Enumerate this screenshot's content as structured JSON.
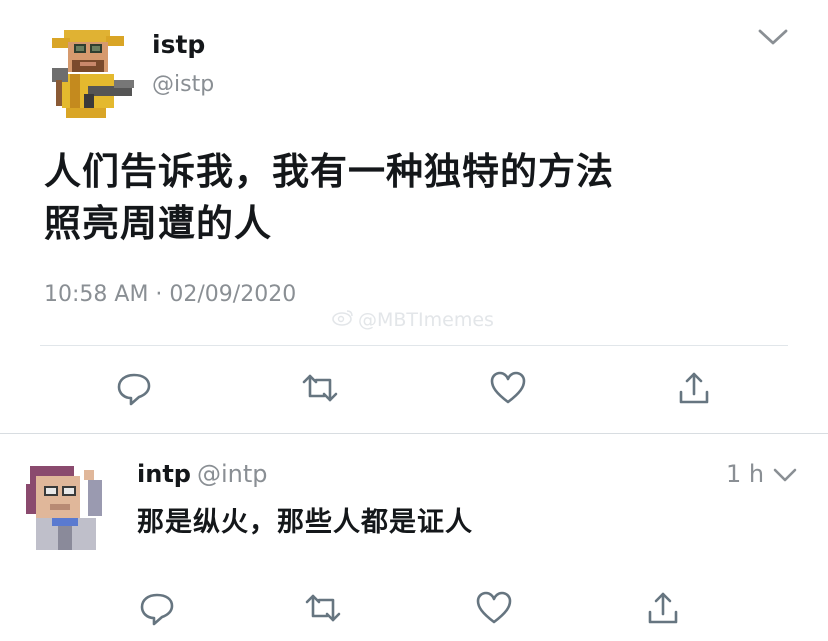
{
  "tweet": {
    "author_name": "istp",
    "author_handle": "@istp",
    "text_line1": "人们告诉我，我有一种独特的方法",
    "text_line2": "照亮周遭的人",
    "timestamp": "10:58 AM · 02/09/2020",
    "watermark": "@MBTImemes",
    "actions": [
      "reply-icon",
      "retweet-icon",
      "like-icon",
      "share-icon"
    ]
  },
  "reply": {
    "author_name": "intp",
    "author_handle": "@intp",
    "time": "1 h",
    "text": "那是纵火，那些人都是证人",
    "actions": [
      "reply-icon",
      "retweet-icon",
      "like-icon",
      "share-icon"
    ]
  },
  "colors": {
    "text": "#14171a",
    "secondary": "#8a8f94",
    "icon": "#667580",
    "divider": "#e1e6ea"
  }
}
